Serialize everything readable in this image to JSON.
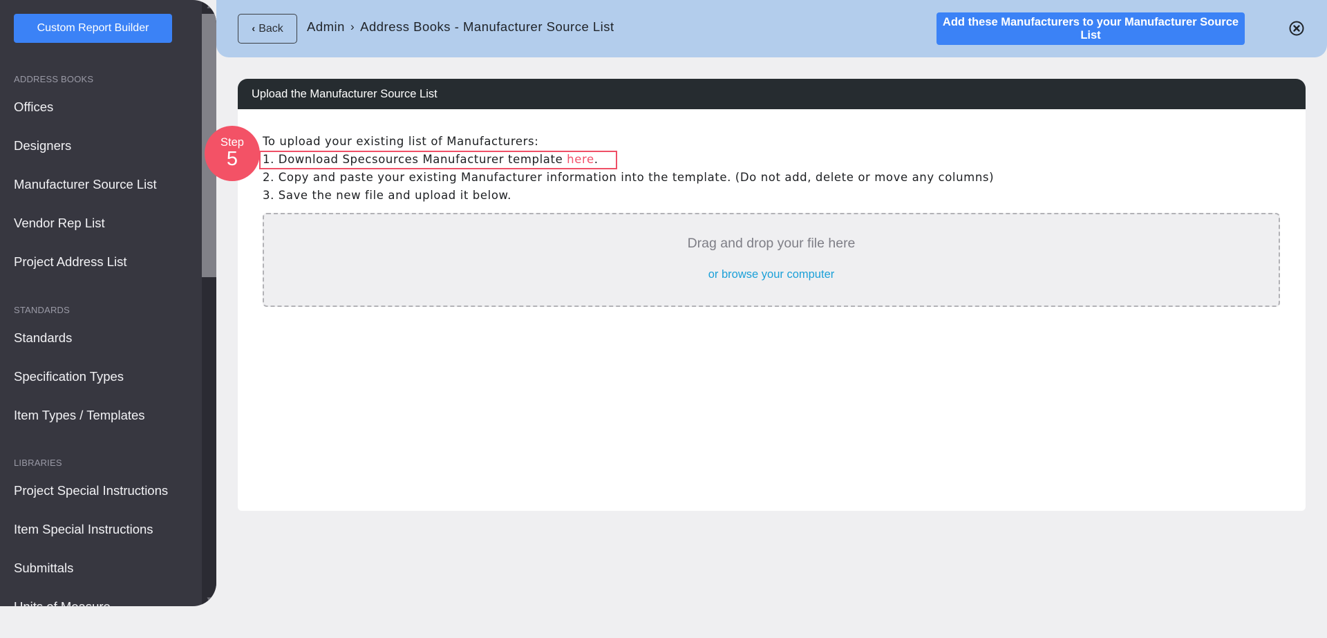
{
  "sidebar": {
    "custom_report_builder": "Custom Report Builder",
    "sections": [
      {
        "label": "ADDRESS BOOKS",
        "items": [
          "Offices",
          "Designers",
          "Manufacturer Source List",
          "Vendor Rep List",
          "Project Address List"
        ]
      },
      {
        "label": "STANDARDS",
        "items": [
          "Standards",
          "Specification Types",
          "Item Types / Templates"
        ]
      },
      {
        "label": "LIBRARIES",
        "items": [
          "Project Special Instructions",
          "Item Special Instructions",
          "Submittals",
          "Units of Measure"
        ]
      }
    ]
  },
  "header": {
    "back_label": "Back",
    "breadcrumb_root": "Admin",
    "breadcrumb_separator": "›",
    "breadcrumb_current": "Address Books - Manufacturer Source List",
    "add_button": "Add these Manufacturers to your Manufacturer Source List"
  },
  "card": {
    "title": "Upload the Manufacturer Source List",
    "intro": "To upload your existing list of Manufacturers:",
    "step1_prefix": "1. Download Specsources Manufacturer template ",
    "step1_link": "here",
    "step1_suffix": ".",
    "step2": "2. Copy and paste your existing Manufacturer information into the template. (Do not add, delete or move any columns)",
    "step3": "3. Save the new file and upload it below.",
    "dropzone_title": "Drag and drop your file here",
    "dropzone_link": "or browse your computer"
  },
  "step_badge": {
    "label": "Step",
    "number": "5"
  },
  "colors": {
    "accent_blue": "#3b82f6",
    "header_bg": "#b3cdec",
    "sidebar_bg": "#373740",
    "highlight_red": "#f35266",
    "link_blue": "#1ba0d8"
  }
}
